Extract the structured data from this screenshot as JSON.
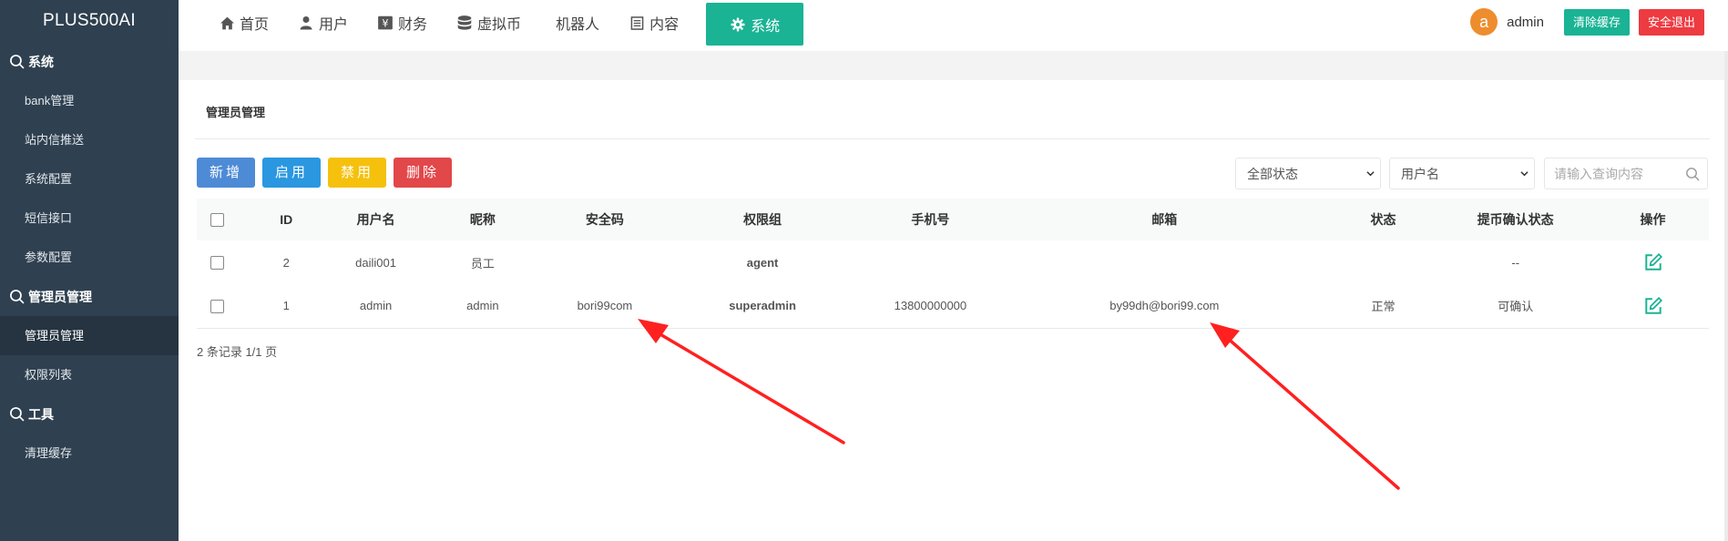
{
  "brand": "PLUS500AI",
  "sidebar": {
    "groups": [
      {
        "label": "系统",
        "items": [
          {
            "label": "bank管理"
          },
          {
            "label": "站内信推送"
          },
          {
            "label": "系统配置"
          },
          {
            "label": "短信接口"
          },
          {
            "label": "参数配置"
          }
        ]
      },
      {
        "label": "管理员管理",
        "items": [
          {
            "label": "管理员管理",
            "active": true
          },
          {
            "label": "权限列表"
          }
        ]
      },
      {
        "label": "工具",
        "items": [
          {
            "label": "清理缓存"
          }
        ]
      }
    ]
  },
  "topnav": {
    "items": [
      {
        "label": "首页",
        "icon": "home-icon"
      },
      {
        "label": "用户",
        "icon": "user-icon"
      },
      {
        "label": "财务",
        "icon": "finance-icon"
      },
      {
        "label": "虚拟币",
        "icon": "database-icon"
      },
      {
        "label": "机器人",
        "icon": ""
      },
      {
        "label": "内容",
        "icon": "document-icon"
      },
      {
        "label": "系统",
        "icon": "gear-icon",
        "active": true
      }
    ]
  },
  "header": {
    "avatar_letter": "a",
    "username": "admin",
    "clear_cache": "清除缓存",
    "logout": "安全退出"
  },
  "page": {
    "title": "管理员管理"
  },
  "actions": {
    "add": "新增",
    "enable": "启用",
    "disable": "禁用",
    "delete": "删除"
  },
  "filters": {
    "status": "全部状态",
    "field": "用户名",
    "search_placeholder": "请输入查询内容"
  },
  "table": {
    "headers": {
      "id": "ID",
      "username": "用户名",
      "nickname": "昵称",
      "security_code": "安全码",
      "role": "权限组",
      "phone": "手机号",
      "email": "邮箱",
      "status": "状态",
      "confirm_status": "提币确认状态",
      "ops": "操作"
    },
    "rows": [
      {
        "id": "2",
        "username": "daili001",
        "nickname": "员工",
        "security_code": "",
        "role": "agent",
        "phone": "",
        "email": "",
        "status": "",
        "confirm_status": "--"
      },
      {
        "id": "1",
        "username": "admin",
        "nickname": "admin",
        "security_code": "bori99com",
        "role": "superadmin",
        "phone": "13800000000",
        "email": "by99dh@bori99.com",
        "status": "正常",
        "confirm_status": "可确认"
      }
    ]
  },
  "pager": "2 条记录 1/1 页",
  "colors": {
    "sidebar": "#2f4050",
    "accent": "#1ab394",
    "danger": "#ed3b41",
    "annotation_arrow": "#ff2020"
  }
}
